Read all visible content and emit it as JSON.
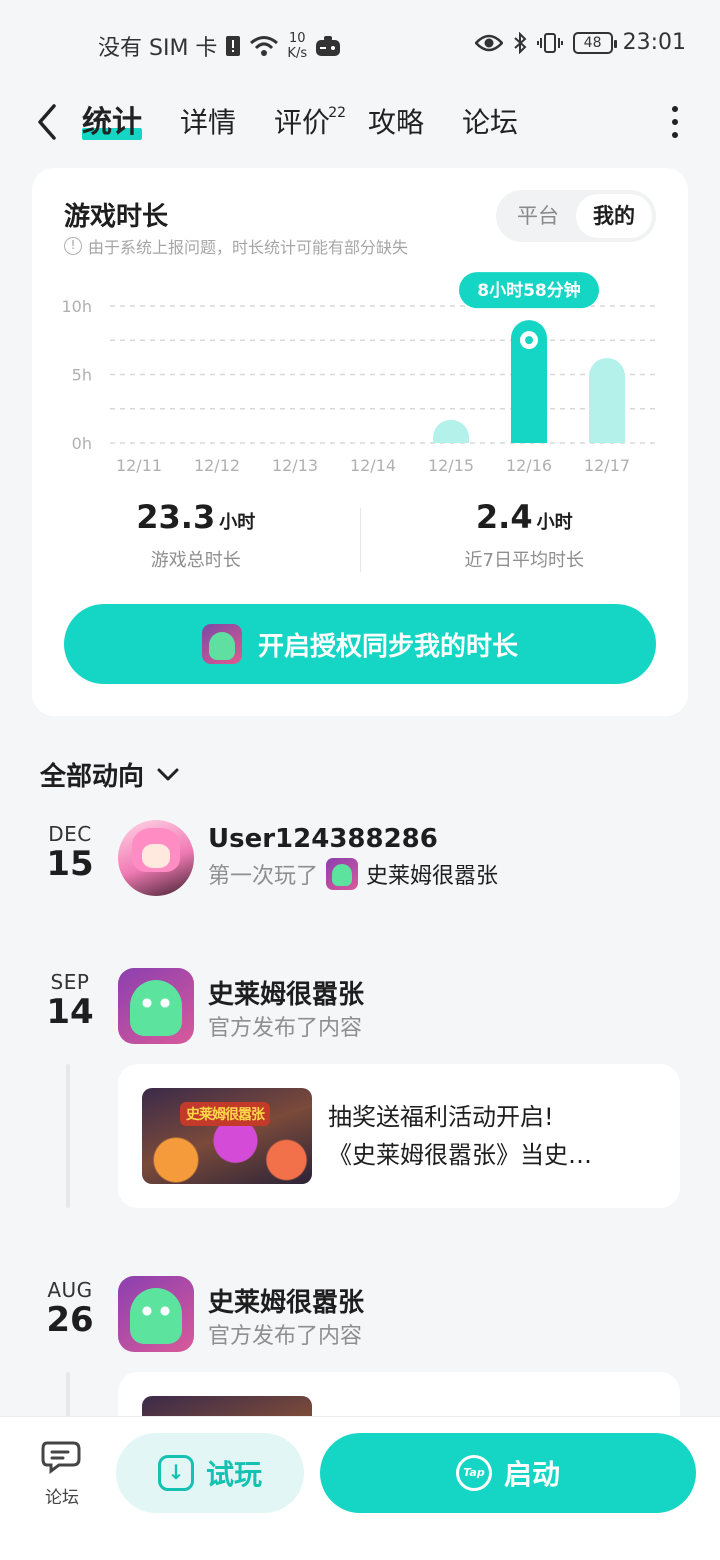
{
  "status_bar": {
    "carrier": "没有 SIM 卡",
    "net_speed_value": "10",
    "net_speed_unit": "K/s",
    "battery": "48",
    "time": "23:01"
  },
  "nav": {
    "tabs": [
      {
        "label": "统计",
        "active": true
      },
      {
        "label": "详情"
      },
      {
        "label": "评价",
        "badge": "22"
      },
      {
        "label": "攻略"
      },
      {
        "label": "论坛"
      }
    ]
  },
  "playtime_card": {
    "title": "游戏时长",
    "note": "由于系统上报问题，时长统计可能有部分缺失",
    "toggle": {
      "options": [
        "平台",
        "我的"
      ],
      "selected": "我的"
    },
    "tooltip": "8小时58分钟",
    "total_value": "23.3",
    "total_unit": "小时",
    "total_label": "游戏总时长",
    "avg_value": "2.4",
    "avg_unit": "小时",
    "avg_label": "近7日平均时长",
    "sync_button": "开启授权同步我的时长"
  },
  "chart_data": {
    "type": "bar",
    "categories": [
      "12/11",
      "12/12",
      "12/13",
      "12/14",
      "12/15",
      "12/16",
      "12/17"
    ],
    "values": [
      0,
      0,
      0,
      0,
      1.7,
      8.97,
      6.2
    ],
    "yticks": [
      "10h",
      "5h",
      "0h"
    ],
    "ylim": [
      0,
      10
    ],
    "highlight_index": 5,
    "colors": {
      "highlight": "#15d6c4",
      "normal": "#b4f1eb",
      "grid": "#d8d8d8"
    }
  },
  "feed": {
    "filter_label": "全部动向",
    "items": [
      {
        "month": "DEC",
        "day": "15",
        "name": "User124388286",
        "action": "第一次玩了",
        "game": "史莱姆很嚣张"
      },
      {
        "month": "SEP",
        "day": "14",
        "name": "史莱姆很嚣张",
        "action": "官方发布了内容",
        "post_line1": "抽奖送福利活动开启!",
        "post_line2": "《史莱姆很嚣张》当史…",
        "post_logo": "史莱姆很嚣张"
      },
      {
        "month": "AUG",
        "day": "26",
        "name": "史莱姆很嚣张",
        "action": "官方发布了内容"
      }
    ]
  },
  "bottom_bar": {
    "forum_label": "论坛",
    "try_label": "试玩",
    "launch_label": "启动",
    "tap_logo": "Tap"
  }
}
